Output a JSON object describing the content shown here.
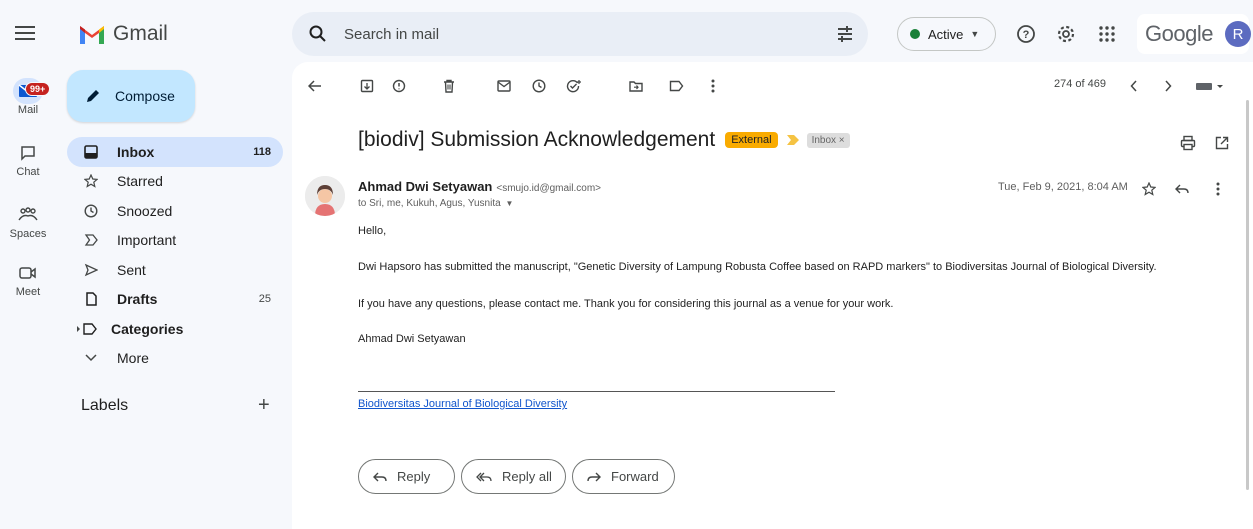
{
  "app": {
    "name": "Gmail",
    "brand_word": "Google",
    "account_initial": "R"
  },
  "search": {
    "placeholder": "Search in mail"
  },
  "status": {
    "label": "Active",
    "color": "#188038"
  },
  "rail": {
    "mail_badge": "99+",
    "items": [
      {
        "label": "Mail",
        "icon": "mail-icon"
      },
      {
        "label": "Chat",
        "icon": "chat-icon"
      },
      {
        "label": "Spaces",
        "icon": "spaces-icon"
      },
      {
        "label": "Meet",
        "icon": "meet-icon"
      }
    ]
  },
  "compose_label": "Compose",
  "nav": {
    "items": [
      {
        "label": "Inbox",
        "count": "118",
        "icon": "inbox-icon"
      },
      {
        "label": "Starred",
        "count": "",
        "icon": "star-icon"
      },
      {
        "label": "Snoozed",
        "count": "",
        "icon": "clock-icon"
      },
      {
        "label": "Important",
        "count": "",
        "icon": "important-icon"
      },
      {
        "label": "Sent",
        "count": "",
        "icon": "send-icon"
      },
      {
        "label": "Drafts",
        "count": "25",
        "icon": "draft-icon"
      },
      {
        "label": "Categories",
        "count": "",
        "icon": "label-icon"
      },
      {
        "label": "More",
        "count": "",
        "icon": "chevron-down-icon"
      }
    ],
    "labels_heading": "Labels",
    "labels_add": "+"
  },
  "toolbar": {
    "pager": "274 of 469"
  },
  "email": {
    "subject": "[biodiv] Submission Acknowledgement",
    "tag_external": "External",
    "tag_inbox": "Inbox ×",
    "sender_name": "Ahmad Dwi Setyawan",
    "sender_email": "<smujo.id@gmail.com>",
    "to_line": "to Sri, me, Kukuh, Agus, Yusnita",
    "date": "Tue, Feb 9, 2021, 8:04 AM",
    "greeting": "Hello,",
    "paragraph1": "Dwi Hapsoro has submitted the manuscript, \"Genetic Diversity of Lampung Robusta Coffee based on RAPD markers\" to Biodiversitas Journal of Biological Diversity.",
    "paragraph2": "If you have any questions, please contact me. Thank you for considering this journal as a venue for your work.",
    "signature": "Ahmad Dwi Setyawan",
    "footer_link": "Biodiversitas Journal of Biological Diversity"
  },
  "actions": {
    "reply": "Reply",
    "reply_all": "Reply all",
    "forward": "Forward"
  }
}
